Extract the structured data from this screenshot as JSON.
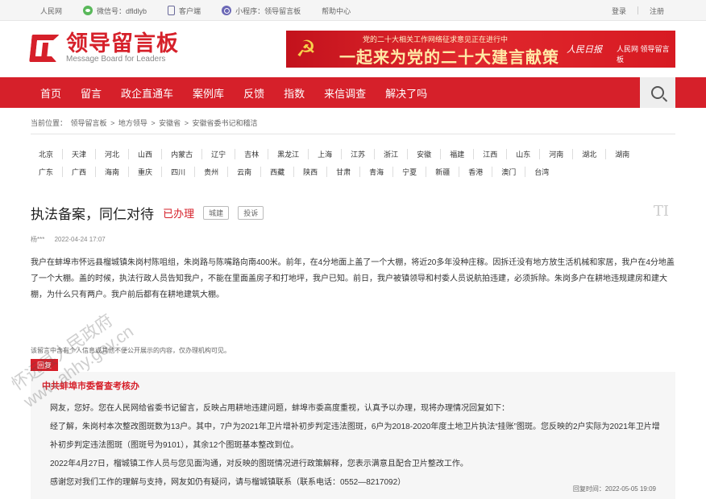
{
  "topbar": {
    "links": [
      {
        "label": "人民网",
        "icon": ""
      },
      {
        "label": "微信号：dfldlyb",
        "icon": "wechat-icon"
      },
      {
        "label": "客户端",
        "icon": "phone-icon"
      },
      {
        "label": "小程序：领导留言板",
        "icon": "miniprogram-icon"
      },
      {
        "label": "帮助中心",
        "icon": ""
      }
    ],
    "login": "登录",
    "register": "注册"
  },
  "logo": {
    "cn": "领导留言板",
    "en": "Message Board for Leaders"
  },
  "banner": {
    "sub": "党的二十大相关工作网络征求意见正在进行中",
    "main": "一起来为党的二十大建言献策",
    "brand1": "人民日报",
    "brand2": "人民网 领导留言板"
  },
  "nav": [
    "首页",
    "留言",
    "政企直通车",
    "案例库",
    "反馈",
    "指数",
    "来信调查",
    "解决了吗"
  ],
  "breadcrumb": [
    "当前位置：",
    "领导留言板",
    ">",
    "地方领导",
    ">",
    "安徽省",
    ">",
    "安徽省委书记和稽洁"
  ],
  "provinces": [
    [
      "北京",
      "天津",
      "河北",
      "山西",
      "内蒙古",
      "辽宁",
      "吉林",
      "黑龙江",
      "上海",
      "江苏",
      "浙江",
      "安徽",
      "福建",
      "江西",
      "山东",
      "河南",
      "湖北",
      "湖南"
    ],
    [
      "广东",
      "广西",
      "海南",
      "重庆",
      "四川",
      "贵州",
      "云南",
      "西藏",
      "陕西",
      "甘肃",
      "青海",
      "宁夏",
      "新疆",
      "香港",
      "澳门",
      "台湾"
    ]
  ],
  "post": {
    "title": "执法备案，同仁对待",
    "status": "已办理",
    "tag1": "城建",
    "tag2": "投诉",
    "author": "杨***",
    "time": "2022-04-24 17:07",
    "content": "我户在蚌埠市怀远县榴城镇朱岗村陈咀组，朱岗路与陈嘴路向南400米。前年，在4分地面上盖了一个大棚，将近20多年没种庄稼。因拆迁没有地方放生活机械和家居，我户在4分地盖了一个大棚。盖的时候，执法行政人员告知我户，不能在里面盖房子和打地坪，我户已知。前日，我户被镇领导和村委人员说航拍违建，必须拆除。朱岗多户在耕地违规建房和建大棚，为什么只有两户。我户前后都有在耕地建筑大棚。",
    "note": "该留言中含有个人信息或其他不便公开展示的内容，仅办理机构可见。"
  },
  "reply": {
    "label": "回复",
    "org": "中共蚌埠市委督查考核办",
    "paragraphs": [
      "网友，您好。您在人民网给省委书记留言，反映占用耕地违建问题，蚌埠市委高度重视，认真予以办理，现将办理情况回复如下：",
      "经了解，朱岗村本次整改图斑数为13户。其中，7户为2021年卫片增补初步判定违法图斑，6户为2018-2020年度土地卫片执法“挂账”图斑。您反映的2户实际为2021年卫片增补初步判定违法图斑（图斑号为9101），其余12个图斑基本整改到位。",
      "2022年4月27日，榴城镇工作人员与您见面沟通，对反映的图斑情况进行政策解释，您表示满意且配合卫片整改工作。",
      "感谢您对我们工作的理解与支持，网友如仍有疑问，请与榴城镇联系（联系电话：0552—8217092）"
    ],
    "time": "回复时间：2022-05-05 19:09"
  },
  "watermark": {
    "line1": "怀远县人民政府",
    "line2": "www.ahhy.gov.cn"
  },
  "colors": {
    "accent": "#d6202a",
    "topbar_bg": "#f5f5f5",
    "reply_bg": "#f6f6f6"
  }
}
